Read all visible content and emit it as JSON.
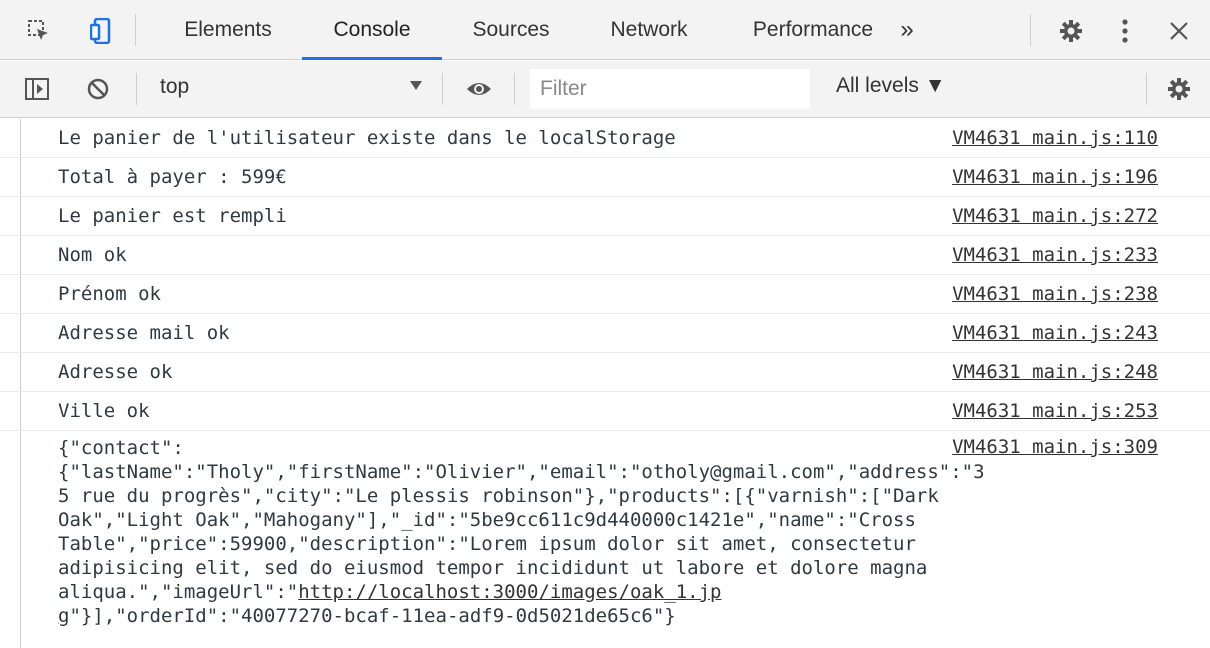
{
  "tabs": [
    {
      "label": "Elements"
    },
    {
      "label": "Console"
    },
    {
      "label": "Sources"
    },
    {
      "label": "Network"
    },
    {
      "label": "Performance"
    }
  ],
  "more_tabs": "»",
  "toolbar": {
    "context": "top",
    "filter_placeholder": "Filter",
    "levels": "All levels ▼"
  },
  "console": {
    "messages": [
      {
        "text": "Le panier de l'utilisateur existe dans le localStorage",
        "source": "VM4631 main.js:110"
      },
      {
        "text": "Total à payer : 599€",
        "source": "VM4631 main.js:196"
      },
      {
        "text": "Le panier est rempli",
        "source": "VM4631 main.js:272"
      },
      {
        "text": "Nom ok",
        "source": "VM4631 main.js:233"
      },
      {
        "text": "Prénom ok",
        "source": "VM4631 main.js:238"
      },
      {
        "text": "Adresse mail ok",
        "source": "VM4631 main.js:243"
      },
      {
        "text": "Adresse ok",
        "source": "VM4631 main.js:248"
      },
      {
        "text": "Ville ok",
        "source": "VM4631 main.js:253"
      }
    ],
    "json_message": {
      "source": "VM4631 main.js:309",
      "line1": "{\"contact\":",
      "line2": "{\"lastName\":\"Tholy\",\"firstName\":\"Olivier\",\"email\":\"otholy@gmail.com\",\"address\":\"3",
      "line3": "5 rue du progrès\",\"city\":\"Le plessis robinson\"},\"products\":[{\"varnish\":[\"Dark",
      "line4": "Oak\",\"Light Oak\",\"Mahogany\"],\"_id\":\"5be9cc611c9d440000c1421e\",\"name\":\"Cross",
      "line5": "Table\",\"price\":59900,\"description\":\"Lorem ipsum dolor sit amet, consectetur",
      "line6": "adipisicing elit, sed do eiusmod tempor incididunt ut labore et dolore magna",
      "line7_prefix": "aliqua.\",\"imageUrl\":\"",
      "line7_link": "http://localhost:3000/images/oak_1.jp",
      "line8_link": "g",
      "line8_suffix": "\"}],\"orderId\":\"40077270-bcaf-11ea-adf9-0d5021de65c6\"}"
    }
  }
}
